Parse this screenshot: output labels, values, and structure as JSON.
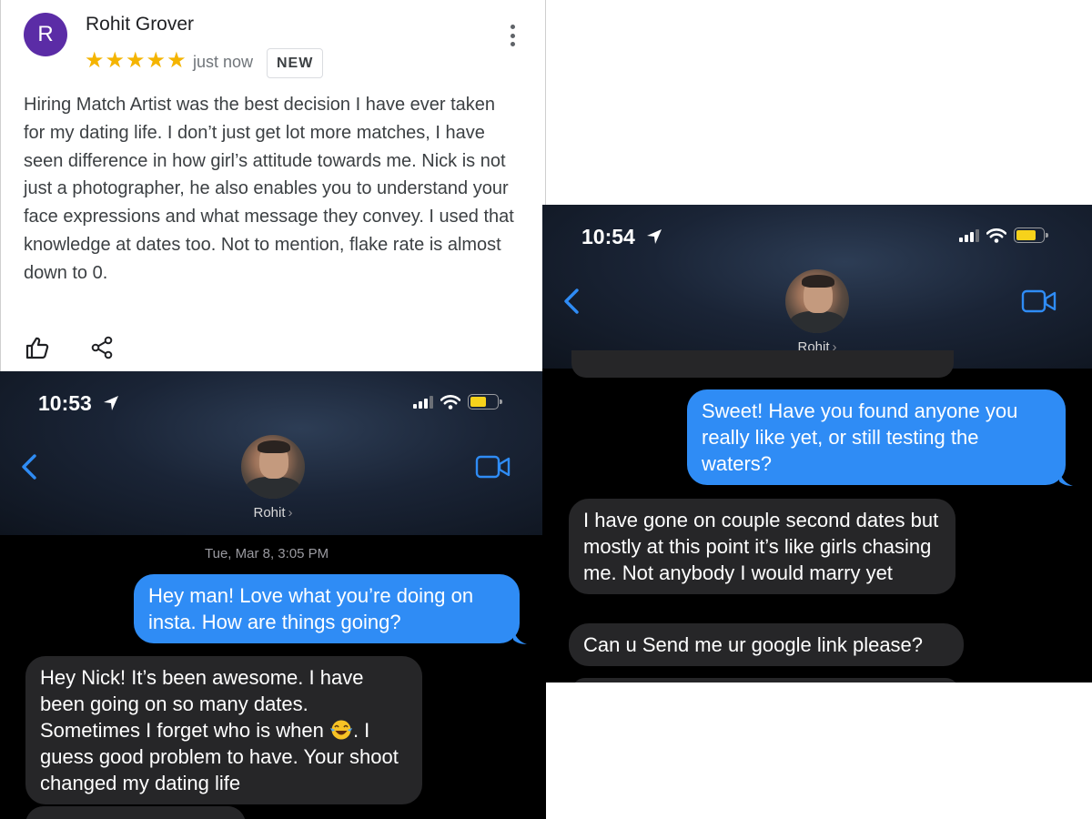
{
  "review": {
    "avatar_letter": "R",
    "author": "Rohit Grover",
    "stars": "★★★★★",
    "time": "just now",
    "badge": "NEW",
    "text": "Hiring Match Artist was the best decision I have ever taken for my dating life. I don’t just get lot more matches, I have seen difference in how girl’s attitude towards me. Nick is not just a photographer, he also enables you to understand your face expressions and what message they convey. I used that knowledge at dates too. Not to mention, flake rate is almost down to 0.",
    "rating": 5,
    "colors": {
      "avatar": "#5b2ca6",
      "star": "#f4b400"
    }
  },
  "chat1": {
    "time": "10:53",
    "contact": "Rohit",
    "timestamp": "Tue, Mar 8, 3:05 PM",
    "messages": {
      "m1": "Hey man! Love what you’re doing on insta. How are things going?",
      "m2_a": "Hey Nick! It’s been awesome. I have been going on so many dates. Sometimes I forget who is when",
      "m2_b": ". I guess good problem to have. Your shoot changed my dating life"
    },
    "emoji": "face-with-tears-of-joy-icon"
  },
  "chat2": {
    "time": "10:54",
    "contact": "Rohit",
    "messages": {
      "m1": "Sweet! Have you found anyone you really like yet, or still testing the waters?",
      "m2": "I have gone on couple second dates but mostly at this point it’s like girls chasing me. Not anybody I would marry yet",
      "m3": "Can u Send me ur google link please?"
    }
  },
  "colors": {
    "outgoing_bubble": "#2f8cf5",
    "incoming_bubble": "#262628",
    "ios_blue": "#2f8cf5",
    "battery": "#f7d21b"
  }
}
